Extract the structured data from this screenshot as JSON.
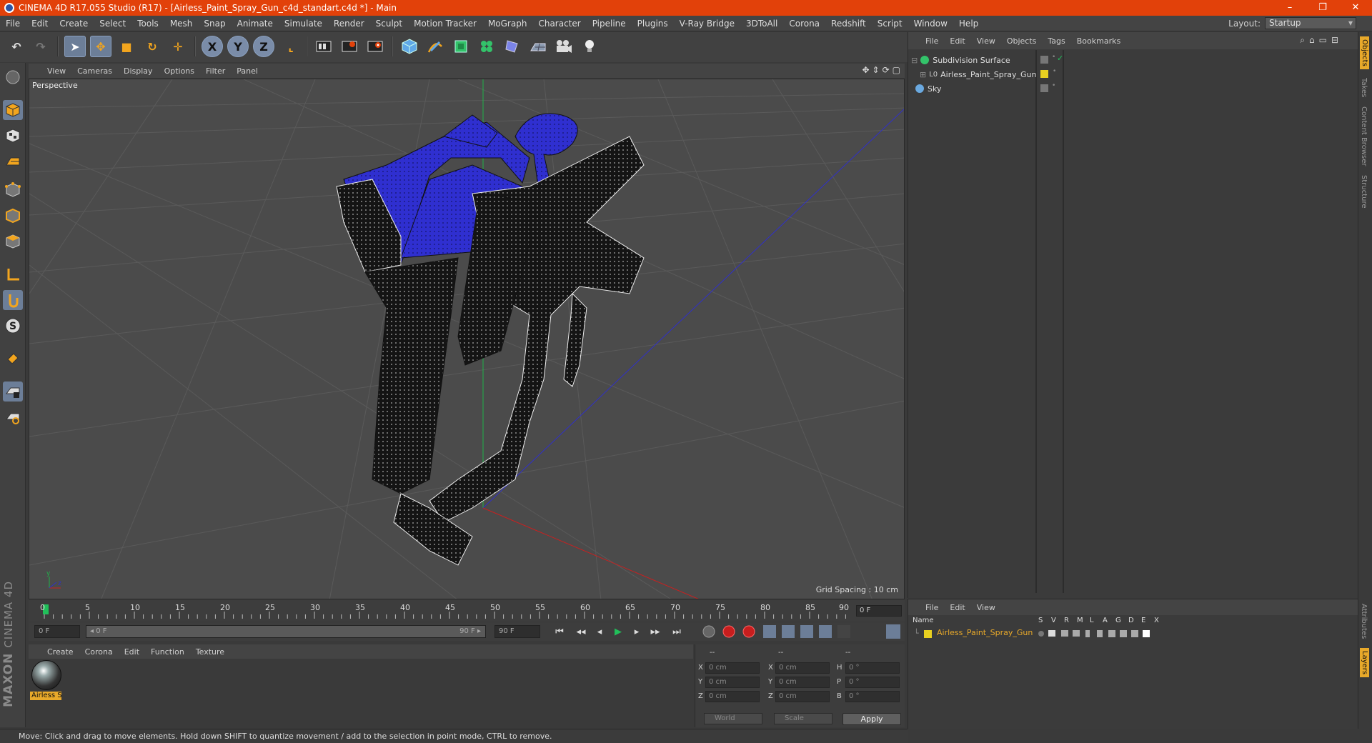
{
  "window": {
    "title": "CINEMA 4D R17.055 Studio (R17) - [Airless_Paint_Spray_Gun_c4d_standart.c4d *] - Main",
    "minimize": "–",
    "restore": "❐",
    "close": "✕"
  },
  "menubar": {
    "items": [
      "File",
      "Edit",
      "Create",
      "Select",
      "Tools",
      "Mesh",
      "Snap",
      "Animate",
      "Simulate",
      "Render",
      "Sculpt",
      "Motion Tracker",
      "MoGraph",
      "Character",
      "Pipeline",
      "Plugins",
      "V-Ray Bridge",
      "3DToAll",
      "Corona",
      "Redshift",
      "Script",
      "Window",
      "Help"
    ],
    "layout_label": "Layout:",
    "layout_value": "Startup"
  },
  "toolbar": {
    "undo": "↶",
    "redo": "↷",
    "select": "➤",
    "move": "✥",
    "scale": "■",
    "rotate": "↻",
    "transform": "✛",
    "x": "X",
    "y": "Y",
    "z": "Z",
    "coord": "⌞"
  },
  "viewport": {
    "menu": [
      "View",
      "Cameras",
      "Display",
      "Options",
      "Filter",
      "Panel"
    ],
    "label": "Perspective",
    "grid_spacing": "Grid Spacing : 10 cm",
    "nav_icons": [
      "✥",
      "⇕",
      "⟳",
      "▢"
    ]
  },
  "timeline": {
    "ticks": [
      "0",
      "5",
      "10",
      "15",
      "20",
      "25",
      "30",
      "35",
      "40",
      "45",
      "50",
      "55",
      "60",
      "65",
      "70",
      "75",
      "80",
      "85",
      "90"
    ],
    "current_frame": "0 F",
    "start_field": "0 F",
    "range_start": "◂ 0 F",
    "range_end": "90 F ▸",
    "end_field": "90 F"
  },
  "transport": [
    "⏮",
    "◂◂",
    "◂",
    "▶",
    "▸",
    "▸▸",
    "⏭"
  ],
  "material_manager": {
    "menu": [
      "Create",
      "Corona",
      "Edit",
      "Function",
      "Texture"
    ],
    "material_name": "Airless S"
  },
  "coordinates": {
    "headers": [
      "--",
      "--",
      "--"
    ],
    "rows": [
      {
        "a": "X",
        "av": "0 cm",
        "b": "X",
        "bv": "0 cm",
        "c": "H",
        "cv": "0 °"
      },
      {
        "a": "Y",
        "av": "0 cm",
        "b": "Y",
        "bv": "0 cm",
        "c": "P",
        "cv": "0 °"
      },
      {
        "a": "Z",
        "av": "0 cm",
        "b": "Z",
        "bv": "0 cm",
        "c": "B",
        "cv": "0 °"
      }
    ],
    "mode1": "World",
    "mode2": "Scale",
    "apply": "Apply"
  },
  "object_manager": {
    "menu": [
      "File",
      "Edit",
      "View",
      "Objects",
      "Tags",
      "Bookmarks"
    ],
    "objects": [
      {
        "name": "Subdivision Surface",
        "color": "#33c36a"
      },
      {
        "name": "Airless_Paint_Spray_Gun",
        "color": "#aaaaaa"
      },
      {
        "name": "Sky",
        "color": "#6aa9e0"
      }
    ]
  },
  "layer_manager": {
    "menu": [
      "File",
      "Edit",
      "View"
    ],
    "columns": [
      "Name",
      "S",
      "V",
      "R",
      "M",
      "L",
      "A",
      "G",
      "D",
      "E",
      "X"
    ],
    "layer": "Airless_Paint_Spray_Gun"
  },
  "side_tabs": [
    "Objects",
    "Takes",
    "Content Browser",
    "Structure",
    "Attributes",
    "Layers"
  ],
  "maxon": {
    "brand": "MAXON",
    "product": "CINEMA 4D"
  },
  "status": "Move: Click and drag to move elements. Hold down SHIFT to quantize movement / add to the selection in point mode, CTRL to remove.",
  "colors": {
    "titlebar": "#e2410a",
    "accent": "#e8a92a",
    "gun_blue": "#2f2fd0"
  }
}
